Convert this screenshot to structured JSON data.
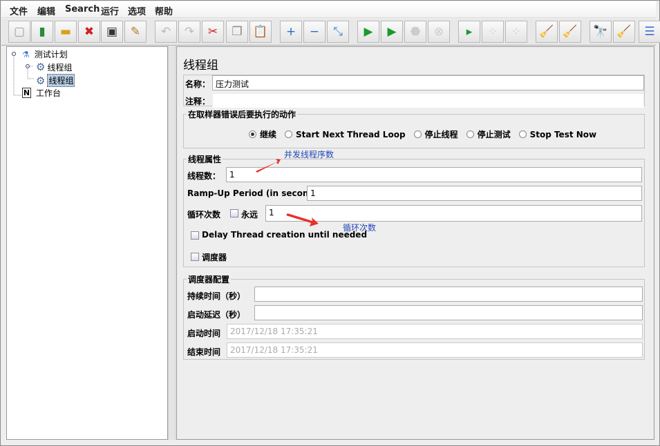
{
  "menu": [
    "文件",
    "编辑",
    "Search",
    "运行",
    "选项",
    "帮助"
  ],
  "toolbar": [
    {
      "icon": "new-icon",
      "glyph": "▢",
      "color": "#999",
      "enabled": true
    },
    {
      "icon": "templates-icon",
      "glyph": "▮",
      "color": "#2a8a3a",
      "enabled": true
    },
    {
      "icon": "open-icon",
      "glyph": "▬",
      "color": "#d9a020",
      "enabled": true
    },
    {
      "icon": "close-icon",
      "glyph": "✖",
      "color": "#d02020",
      "enabled": true
    },
    {
      "icon": "save-icon",
      "glyph": "▣",
      "color": "#333",
      "enabled": true
    },
    {
      "icon": "save-as-icon",
      "glyph": "✎",
      "color": "#b08020",
      "enabled": true
    },
    {
      "icon": "undo-icon",
      "glyph": "↶",
      "color": "#bbb",
      "enabled": false
    },
    {
      "icon": "redo-icon",
      "glyph": "↷",
      "color": "#bbb",
      "enabled": false
    },
    {
      "icon": "cut-icon",
      "glyph": "✂",
      "color": "#d02020",
      "enabled": true
    },
    {
      "icon": "copy-icon",
      "glyph": "❐",
      "color": "#888",
      "enabled": true
    },
    {
      "icon": "paste-icon",
      "glyph": "📋",
      "color": "#a07020",
      "enabled": true
    },
    {
      "icon": "expand-icon",
      "glyph": "+",
      "color": "#2a6ad0",
      "enabled": true
    },
    {
      "icon": "collapse-icon",
      "glyph": "−",
      "color": "#2a6ad0",
      "enabled": true
    },
    {
      "icon": "toggle-icon",
      "glyph": "⤡",
      "color": "#3a8ad0",
      "enabled": true
    },
    {
      "icon": "start-icon",
      "glyph": "▶",
      "color": "#1a9a2a",
      "enabled": true
    },
    {
      "icon": "start-no-pause-icon",
      "glyph": "▶",
      "color": "#1a9a2a",
      "enabled": true
    },
    {
      "icon": "stop-icon",
      "glyph": "⬣",
      "color": "#ccc",
      "enabled": false
    },
    {
      "icon": "shutdown-icon",
      "glyph": "⊗",
      "color": "#ccc",
      "enabled": false
    },
    {
      "icon": "remote-start-icon",
      "glyph": "▸",
      "color": "#1a9a2a",
      "enabled": true
    },
    {
      "icon": "remote-stop-icon",
      "glyph": "⁘",
      "color": "#ccc",
      "enabled": false
    },
    {
      "icon": "remote-shutdown-icon",
      "glyph": "⁘",
      "color": "#ccc",
      "enabled": false
    },
    {
      "icon": "clear-icon",
      "glyph": "🧹",
      "color": "#a08040",
      "enabled": true
    },
    {
      "icon": "clear-all-icon",
      "glyph": "🧹",
      "color": "#a08040",
      "enabled": true
    },
    {
      "icon": "search-icon",
      "glyph": "🔭",
      "color": "#222",
      "enabled": true
    },
    {
      "icon": "reset-search-icon",
      "glyph": "🧹",
      "color": "#e0b020",
      "enabled": true
    },
    {
      "icon": "function-helper-icon",
      "glyph": "☰",
      "color": "#3a6ad0",
      "enabled": true
    }
  ],
  "tree": {
    "plan": "测试计划",
    "thread_group_1": "线程组",
    "thread_group_2": "线程组",
    "workbench": "工作台"
  },
  "panel": {
    "title": "线程组",
    "name_label": "名称：",
    "name_value": "压力测试",
    "comment_label": "注释：",
    "comment_value": "",
    "error_action": {
      "legend": "在取样器错误后要执行的动作",
      "options": [
        "继续",
        "Start Next Thread Loop",
        "停止线程",
        "停止测试",
        "Stop Test Now"
      ],
      "selected": "继续"
    },
    "thread_props": {
      "legend": "线程属性",
      "threads_label": "线程数：",
      "threads_value": "1",
      "rampup_label": "Ramp-Up Period (in seconds):",
      "rampup_value": "1",
      "loop_label": "循环次数",
      "forever_label": "永远",
      "forever_checked": false,
      "loop_value": "1",
      "delay_label": "Delay Thread creation until needed",
      "delay_checked": false,
      "scheduler_label": "调度器",
      "scheduler_checked": false
    },
    "scheduler": {
      "legend": "调度器配置",
      "duration_label": "持续时间（秒）",
      "duration_value": "",
      "delay_label": "启动延迟（秒）",
      "delay_value": "",
      "start_label": "启动时间",
      "start_value": "2017/12/18 17:35:21",
      "end_label": "结束时间",
      "end_value": "2017/12/18 17:35:21"
    }
  },
  "annotations": {
    "threads_note": "并发线程序数",
    "loop_note": "循环次数",
    "color": "#2346b8",
    "arrow_color": "#e8302a"
  }
}
